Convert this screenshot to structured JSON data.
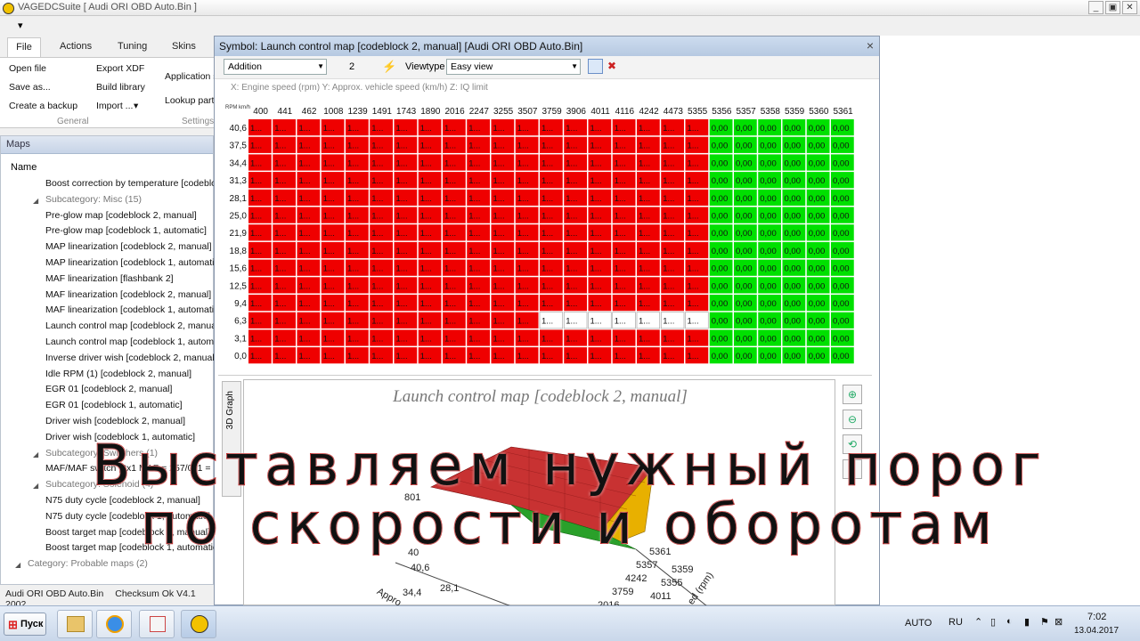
{
  "window": {
    "title": "VAGEDCSuite [ Audi ORI OBD Auto.Bin ]",
    "minimize": "_",
    "restore": "▣",
    "close": "✕"
  },
  "quickbar": {
    "dropdown": "▾"
  },
  "ribbon": {
    "tabs": [
      "File",
      "Actions",
      "Tuning",
      "Skins"
    ],
    "general": {
      "open_file": "Open file",
      "save_as": "Save as...",
      "create_backup": "Create a backup",
      "export_xdf": "Export XDF",
      "build_library": "Build library",
      "import": "Import ...",
      "group_label": "General"
    },
    "settings": {
      "application": "Application s",
      "lookup": "Lookup part",
      "group_label": "Settings"
    }
  },
  "maps_panel": {
    "title": "Maps",
    "column": "Name",
    "rows": [
      {
        "label": "Boost correction by temperature [codeblock",
        "kind": "item"
      },
      {
        "label": "Subcategory: Misc (15)",
        "kind": "sub"
      },
      {
        "label": "Pre-glow map [codeblock 2, manual]",
        "kind": "item"
      },
      {
        "label": "Pre-glow map [codeblock 1, automatic]",
        "kind": "item"
      },
      {
        "label": "MAP linearization [codeblock 2, manual]",
        "kind": "item"
      },
      {
        "label": "MAP linearization [codeblock 1, automatic]",
        "kind": "item"
      },
      {
        "label": "MAF linearization [flashbank 2]",
        "kind": "item"
      },
      {
        "label": "MAF linearization [codeblock 2, manual]",
        "kind": "item"
      },
      {
        "label": "MAF linearization [codeblock 1, automatic]",
        "kind": "item"
      },
      {
        "label": "Launch control map [codeblock 2, manual]",
        "kind": "item"
      },
      {
        "label": "Launch control map [codeblock 1, automatic]",
        "kind": "item"
      },
      {
        "label": "Inverse driver wish [codeblock 2, manual]",
        "kind": "item"
      },
      {
        "label": "Idle RPM (1) [codeblock 2, manual]",
        "kind": "item"
      },
      {
        "label": "EGR 01 [codeblock 2, manual]",
        "kind": "item"
      },
      {
        "label": "EGR 01 [codeblock 1, automatic]",
        "kind": "item"
      },
      {
        "label": "Driver wish [codeblock 2, manual]",
        "kind": "item"
      },
      {
        "label": "Driver wish [codeblock 1, automatic]",
        "kind": "item"
      },
      {
        "label": "Subcategory: Switchers (1)",
        "kind": "sub"
      },
      {
        "label": "MAF/MAF switch [0x1 MAF = 257/0x1 = ",
        "kind": "item"
      },
      {
        "label": "Subcategory: Solenoid (4)",
        "kind": "sub"
      },
      {
        "label": "N75 duty cycle [codeblock 2, manual]",
        "kind": "item"
      },
      {
        "label": "N75 duty cycle [codeblock 1, automatic]",
        "kind": "item"
      },
      {
        "label": "Boost target map [codeblock 2, manual]",
        "kind": "item"
      },
      {
        "label": "Boost target map [codeblock 1, automatic]",
        "kind": "item"
      },
      {
        "label": "Category: Probable maps (2)",
        "kind": "cat"
      }
    ]
  },
  "statusbar": {
    "file": "Audi ORI OBD Auto.Bin",
    "checksum": "Checksum Ok V4.1 2002"
  },
  "symbol_window": {
    "title": "Symbol: Launch control map [codeblock 2, manual] [Audi ORI OBD Auto.Bin]",
    "close": "×",
    "mode": "Addition",
    "mode_value": "2",
    "viewtype_label": "Viewtype",
    "viewtype": "Easy view",
    "axis_info": "X: Engine speed (rpm) Y: Approx. vehicle speed (km/h) Z: IQ limit",
    "corner": "RPM km/h",
    "x_axis": [
      "400",
      "441",
      "462",
      "1008",
      "1239",
      "1491",
      "1743",
      "1890",
      "2016",
      "2247",
      "3255",
      "3507",
      "3759",
      "3906",
      "4011",
      "4116",
      "4242",
      "4473",
      "5355",
      "5356",
      "5357",
      "5358",
      "5359",
      "5360",
      "5361"
    ],
    "y_axis": [
      "40,6",
      "37,5",
      "34,4",
      "31,3",
      "28,1",
      "25,0",
      "21,9",
      "18,8",
      "15,6",
      "12,5",
      "9,4",
      "6,3",
      "3,1",
      "0,0"
    ],
    "red_cell_text": "1...",
    "green_cell_text": "0,00",
    "red_columns": 19,
    "colors": {
      "red": "#ef0000",
      "green": "#00e000",
      "grid_line": "#ffffff"
    },
    "graph": {
      "tab": "3D Graph",
      "title": "Launch control map [codeblock 2, manual]",
      "labels": [
        "801",
        "40",
        "40,6",
        "34,4",
        "28,1",
        "Appro",
        "5361",
        "5357",
        "4242",
        "3759",
        "2016",
        "5359",
        "5355",
        "4011",
        "ed (rpm)"
      ],
      "tools": [
        "zoom-in",
        "zoom-out",
        "rotate",
        "reset"
      ]
    }
  },
  "taskbar": {
    "start": "Пуск",
    "lang_mode": "AUTO",
    "lang": "RU",
    "time": "7:02",
    "date": "13.04.2017"
  },
  "caption": {
    "line1": "Выставляем нужный порог",
    "line2": "по скорости и оборотам"
  }
}
